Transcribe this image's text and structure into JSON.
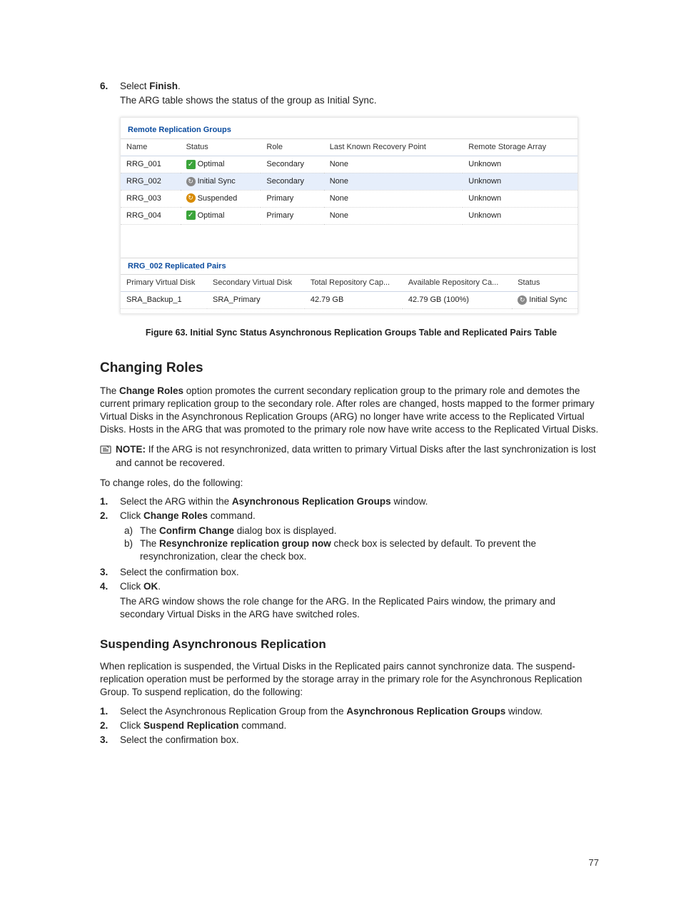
{
  "step6": {
    "num": "6.",
    "line1_prefix": "Select ",
    "line1_bold": "Finish",
    "line1_suffix": ".",
    "line2": "The ARG table shows the status of the group as Initial Sync."
  },
  "fig": {
    "title": "Remote Replication Groups",
    "headers": [
      "Name",
      "Status",
      "Role",
      "Last Known Recovery Point",
      "Remote Storage Array"
    ],
    "rows": [
      {
        "name": "RRG_001",
        "status": "Optimal",
        "icon": "optimal",
        "role": "Secondary",
        "lrp": "None",
        "rsa": "Unknown",
        "selected": false
      },
      {
        "name": "RRG_002",
        "status": "Initial Sync",
        "icon": "sync",
        "role": "Secondary",
        "lrp": "None",
        "rsa": "Unknown",
        "selected": true
      },
      {
        "name": "RRG_003",
        "status": "Suspended",
        "icon": "suspended",
        "role": "Primary",
        "lrp": "None",
        "rsa": "Unknown",
        "selected": false
      },
      {
        "name": "RRG_004",
        "status": "Optimal",
        "icon": "optimal",
        "role": "Primary",
        "lrp": "None",
        "rsa": "Unknown",
        "selected": false
      }
    ],
    "pairs_title": "RRG_002 Replicated Pairs",
    "pairs_headers": [
      "Primary Virtual Disk",
      "Secondary Virtual Disk",
      "Total Repository Cap...",
      "Available Repository Ca...",
      "Status"
    ],
    "pairs_row": {
      "pvd": "SRA_Backup_1",
      "svd": "SRA_Primary",
      "total": "42.79 GB",
      "avail": "42.79 GB (100%)",
      "status": "Initial Sync"
    }
  },
  "caption": "Figure 63. Initial Sync Status Asynchronous Replication Groups Table and Replicated Pairs Table",
  "changingRoles": {
    "heading": "Changing Roles",
    "para1_a": "The ",
    "para1_b": "Change Roles",
    "para1_c": " option promotes the current secondary replication group to the primary role and demotes the current primary replication group to the secondary role. After roles are changed, hosts mapped to the former primary Virtual Disks in the Asynchronous Replication Groups (ARG) no longer have write access to the Replicated Virtual Disks. Hosts in the ARG that was promoted to the primary role now have write access to the Replicated Virtual Disks.",
    "note_label": "NOTE:",
    "note_body": " If the ARG is not resynchronized, data written to primary Virtual Disks after the last synchronization is lost and cannot be recovered.",
    "para2": "To change roles, do the following:",
    "steps": {
      "s1": {
        "num": "1.",
        "a": "Select the ARG within the ",
        "b": "Asynchronous Replication Groups",
        "c": " window."
      },
      "s2": {
        "num": "2.",
        "a": "Click ",
        "b": "Change Roles",
        "c": " command.",
        "sub_a_marker": "a)",
        "sub_a_a": "The ",
        "sub_a_b": "Confirm Change",
        "sub_a_c": " dialog box is displayed.",
        "sub_b_marker": "b)",
        "sub_b_a": "The ",
        "sub_b_b": "Resynchronize replication group now",
        "sub_b_c": " check box is selected by default. To prevent the resynchronization, clear the check box."
      },
      "s3": {
        "num": "3.",
        "text": "Select the confirmation box."
      },
      "s4": {
        "num": "4.",
        "a": "Click ",
        "b": "OK",
        "c": ".",
        "tail": "The ARG window shows the role change for the ARG. In the Replicated Pairs window, the primary and secondary Virtual Disks in the ARG have switched roles."
      }
    }
  },
  "suspend": {
    "heading": "Suspending Asynchronous Replication",
    "para": "When replication is suspended, the Virtual Disks in the Replicated pairs cannot synchronize data. The suspend-replication operation must be performed by the storage array in the primary role for the Asynchronous Replication Group. To suspend replication, do the following:",
    "steps": {
      "s1": {
        "num": "1.",
        "a": "Select the Asynchronous Replication Group from the ",
        "b": "Asynchronous Replication Groups",
        "c": " window."
      },
      "s2": {
        "num": "2.",
        "a": "Click ",
        "b": "Suspend Replication",
        "c": " command."
      },
      "s3": {
        "num": "3.",
        "text": "Select the confirmation box."
      }
    }
  },
  "pagenum": "77"
}
